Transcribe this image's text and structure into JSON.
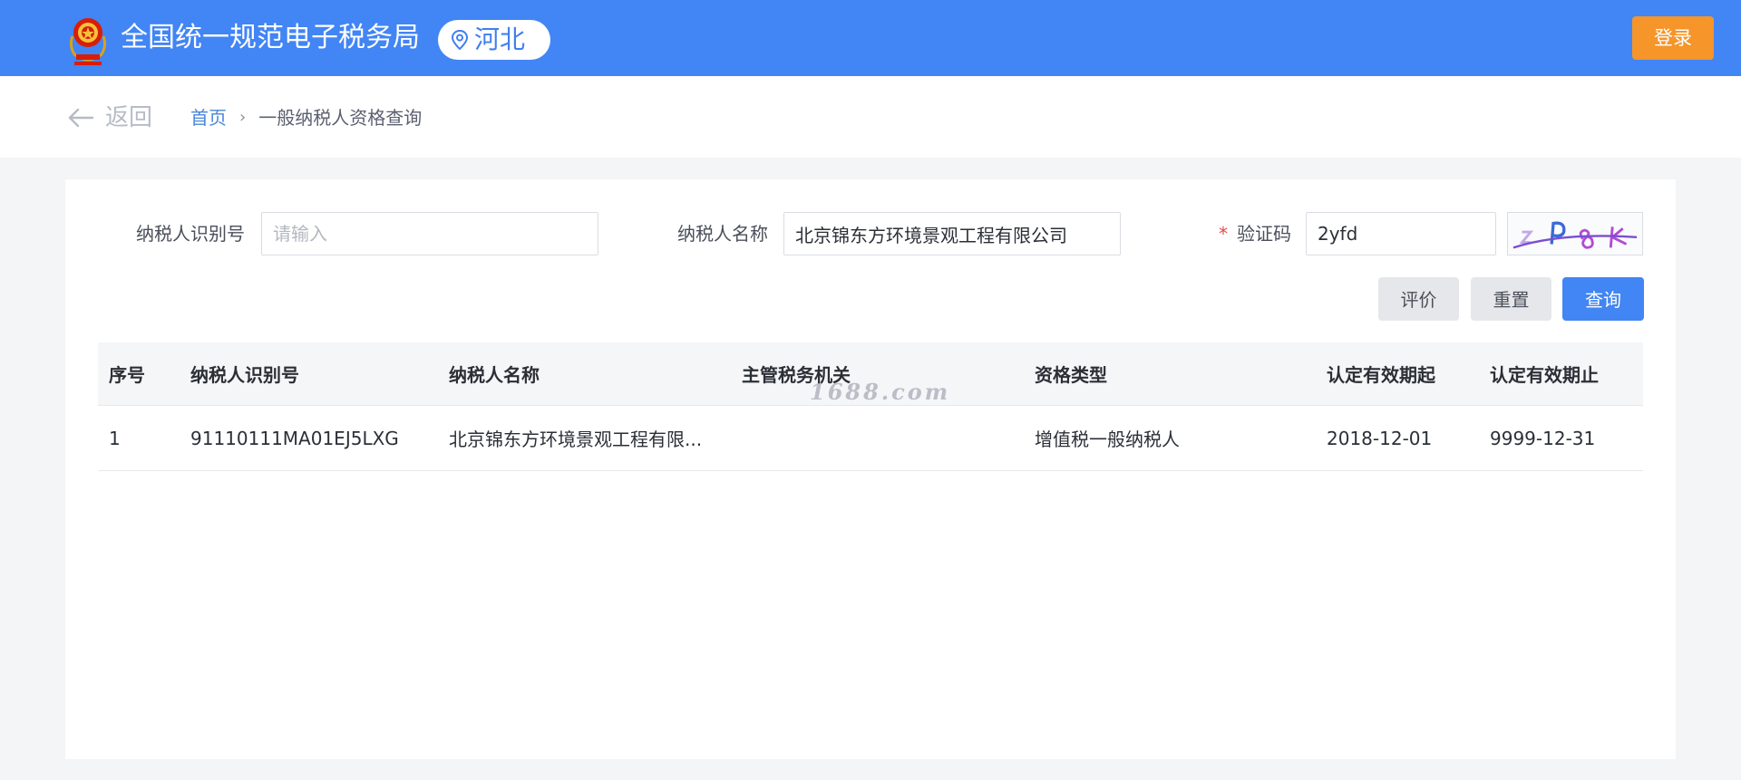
{
  "header": {
    "title": "全国统一规范电子税务局",
    "region": "河北",
    "login_label": "登录",
    "logo_icon": "tax-emblem-icon"
  },
  "breadcrumb": {
    "back_label": "返回",
    "home": "首页",
    "current": "一般纳税人资格查询"
  },
  "form": {
    "taxpayer_id": {
      "label": "纳税人识别号",
      "value": "",
      "placeholder": "请输入"
    },
    "taxpayer_name": {
      "label": "纳税人名称",
      "value": "北京锦东方环境景观工程有限公司",
      "placeholder": ""
    },
    "captcha": {
      "label": "验证码",
      "required_mark": "*",
      "value": "2yfd"
    }
  },
  "buttons": {
    "evaluate": "评价",
    "reset": "重置",
    "search": "查询"
  },
  "table": {
    "columns": [
      "序号",
      "纳税人识别号",
      "纳税人名称",
      "主管税务机关",
      "资格类型",
      "认定有效期起",
      "认定有效期止"
    ],
    "rows": [
      [
        "1",
        "91110111MA01EJ5LXG",
        "北京锦东方环境景观工程有限...",
        "",
        "增值税一般纳税人",
        "2018-12-01",
        "9999-12-31"
      ]
    ]
  },
  "watermark": "1688.com",
  "colors": {
    "brand_blue": "#4285f4",
    "login_orange": "#f5952a",
    "required_red": "#e5484d"
  }
}
